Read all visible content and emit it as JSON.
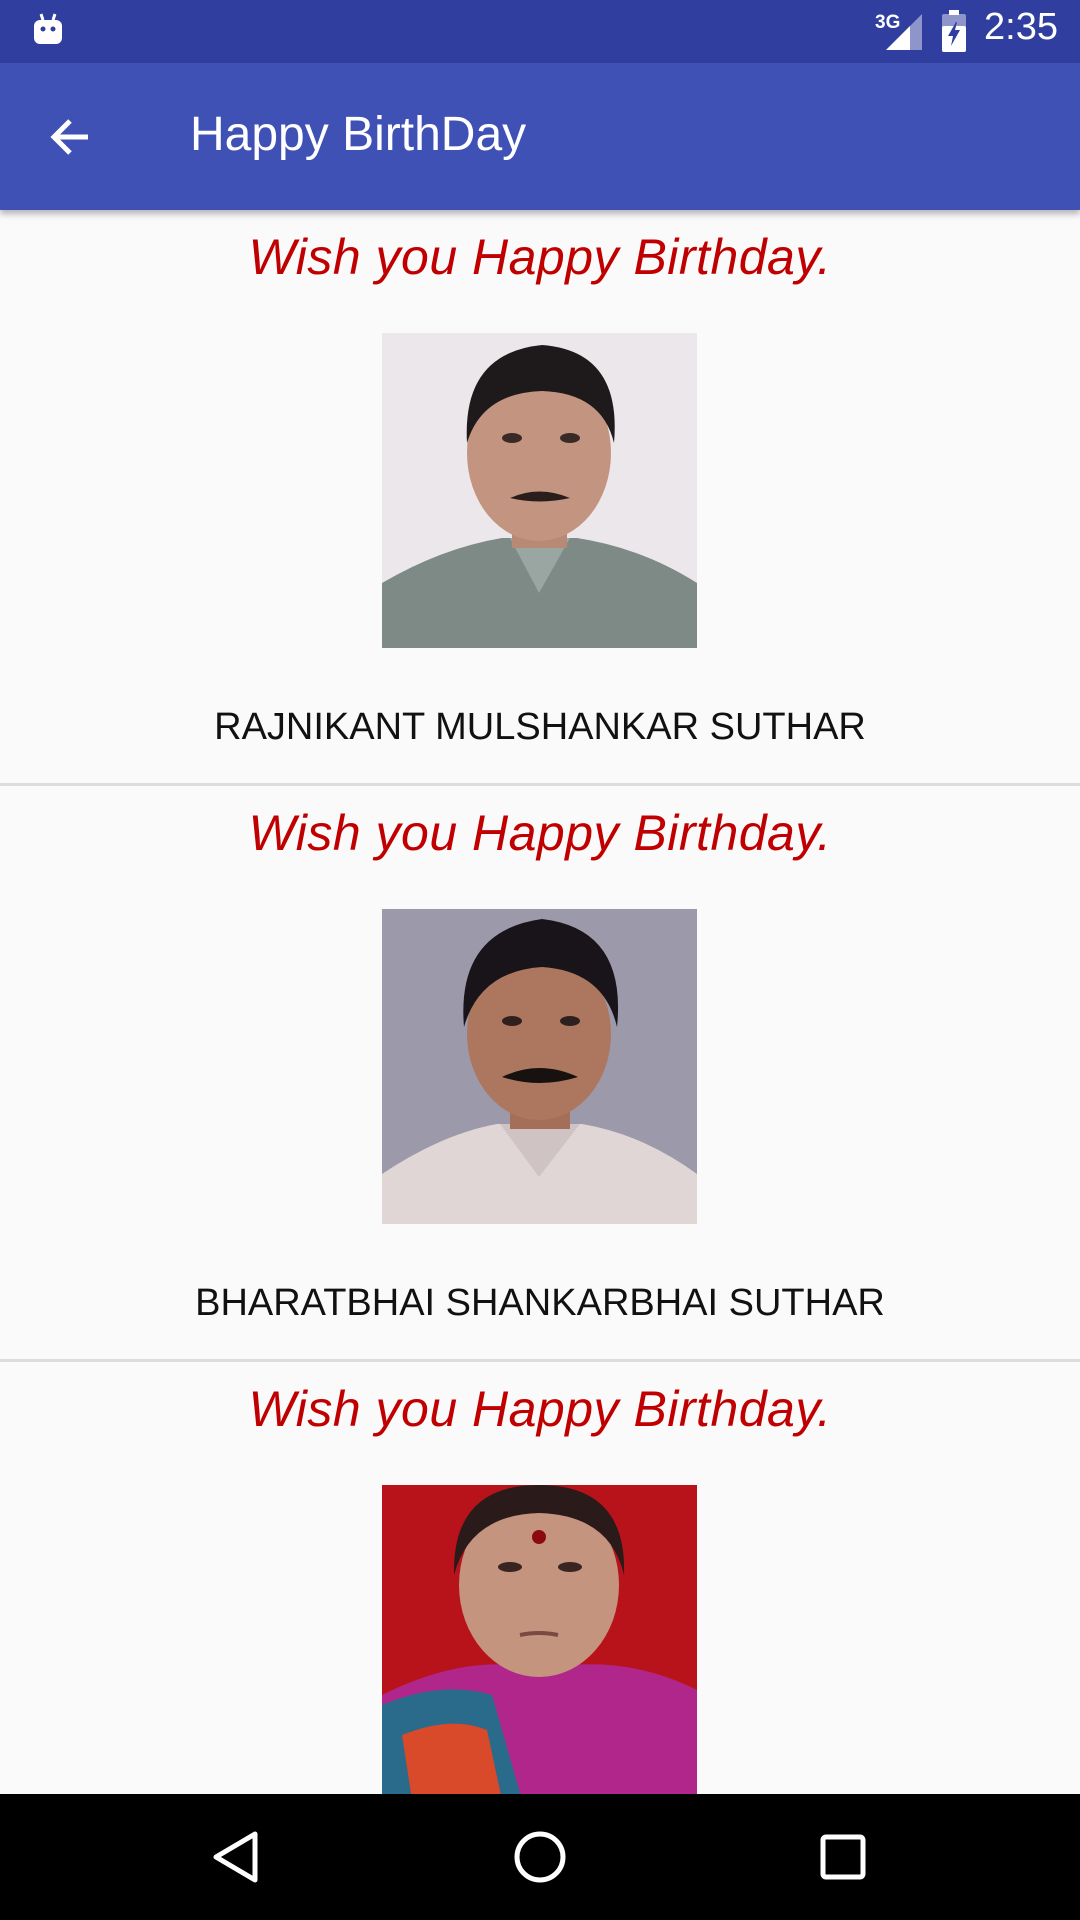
{
  "status_bar": {
    "network": "3G",
    "time": "2:35"
  },
  "app_bar": {
    "title": "Happy BirthDay",
    "back_icon": "arrow-back-icon"
  },
  "cards": [
    {
      "wish": "Wish you Happy Birthday.",
      "name": "RAJNIKANT MULSHANKAR SUTHAR"
    },
    {
      "wish": "Wish you Happy Birthday.",
      "name": "BHARATBHAI SHANKARBHAI SUTHAR"
    },
    {
      "wish": "Wish you Happy Birthday.",
      "name": ""
    }
  ],
  "nav_bar": {
    "icons": [
      "back-triangle-icon",
      "home-circle-icon",
      "recents-square-icon"
    ]
  },
  "colors": {
    "status_bar": "#303f9f",
    "app_bar": "#3f51b5",
    "wish_text": "#c00000",
    "background": "#fafafa"
  }
}
